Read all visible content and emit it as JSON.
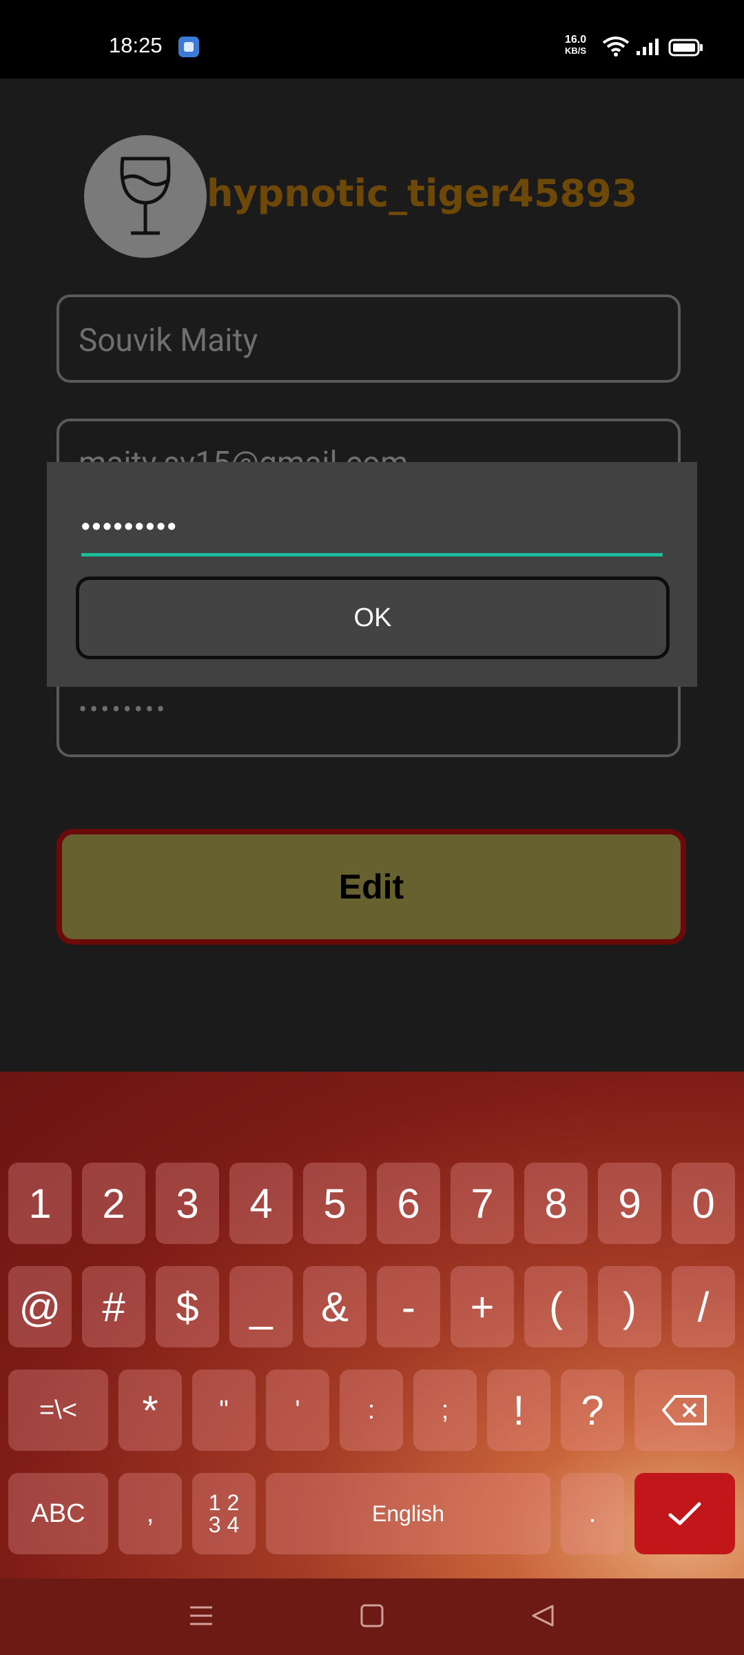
{
  "status_bar": {
    "time": "18:25",
    "net_speed": "16.0",
    "net_unit": "KB/S"
  },
  "profile": {
    "username": "hypnotic_tiger45893",
    "avatar_icon": "wine-glass-icon"
  },
  "form": {
    "name_value": "Souvik Maity",
    "email_value": "maity.sv15@gmail.com",
    "password_masked": "••••••••"
  },
  "dialog": {
    "password_masked": "•••••••••",
    "ok_label": "OK"
  },
  "edit_button_label": "Edit",
  "keyboard": {
    "row1": [
      "1",
      "2",
      "3",
      "4",
      "5",
      "6",
      "7",
      "8",
      "9",
      "0"
    ],
    "row2": [
      "@",
      "#",
      "$",
      "_",
      "&",
      "-",
      "+",
      "(",
      ")",
      "/"
    ],
    "row3": [
      "=\\<",
      "*",
      "\"",
      "'",
      ":",
      ";",
      "!",
      "?"
    ],
    "abc_label": "ABC",
    "comma_label": ",",
    "numpad_label_top": "1 2",
    "numpad_label_bottom": "3 4",
    "space_label": "English",
    "period_label": "."
  },
  "colors": {
    "accent_underline": "#1abc9c",
    "username": "#6e4806",
    "edit_button": "#67612f",
    "edit_border": "#6b0a0a",
    "enter_key": "#c1161a"
  }
}
